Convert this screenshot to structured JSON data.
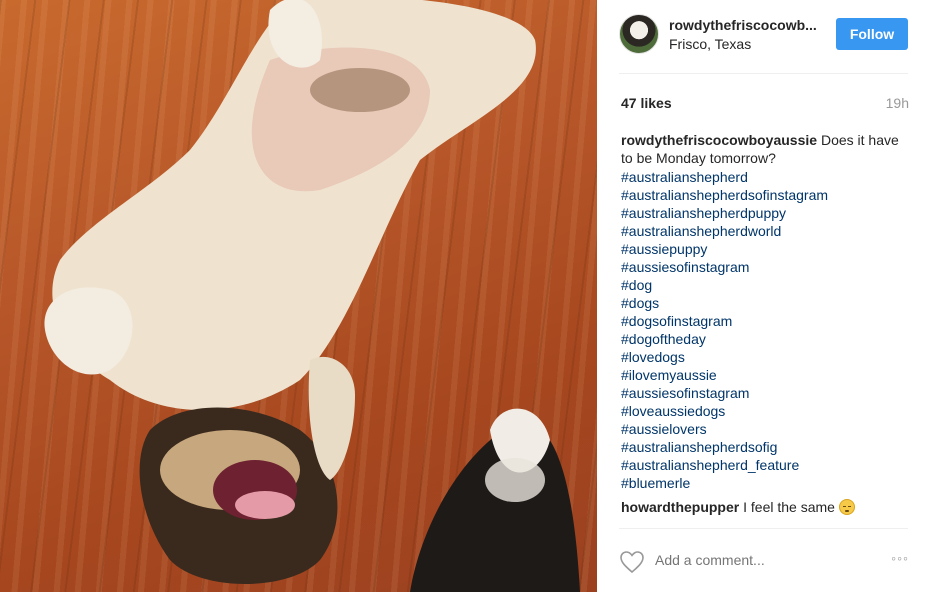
{
  "post": {
    "image_alt": "Puppies lying on a hardwood floor"
  },
  "header": {
    "username": "rowdythefriscocowb...",
    "location": "Frisco, Texas",
    "follow_label": "Follow"
  },
  "stats": {
    "likes": "47 likes",
    "time": "19h"
  },
  "caption": {
    "username": "rowdythefriscocowboyaussie",
    "text": "Does it have to be Monday tomorrow?",
    "hashtags": [
      "#australianshepherd",
      "#australianshepherdsofinstagram",
      "#australianshepherdpuppy",
      "#australianshepherdworld",
      "#aussiepuppy",
      "#aussiesofinstagram",
      "#dog",
      "#dogs",
      "#dogsofinstagram",
      "#dogoftheday",
      "#lovedogs",
      "#ilovemyaussie",
      "#aussiesofinstagram",
      "#loveaussiedogs",
      "#aussielovers",
      "#australianshepherdsofig",
      "#australianshepherd_feature",
      "#bluemerle"
    ]
  },
  "comment": {
    "username": "howardthepupper",
    "text": "I feel the same",
    "emoji": "sleepy-face-emoji"
  },
  "actions": {
    "add_comment_placeholder": "Add a comment...",
    "more_label": "◦◦◦",
    "like_icon": "heart-outline-icon"
  }
}
